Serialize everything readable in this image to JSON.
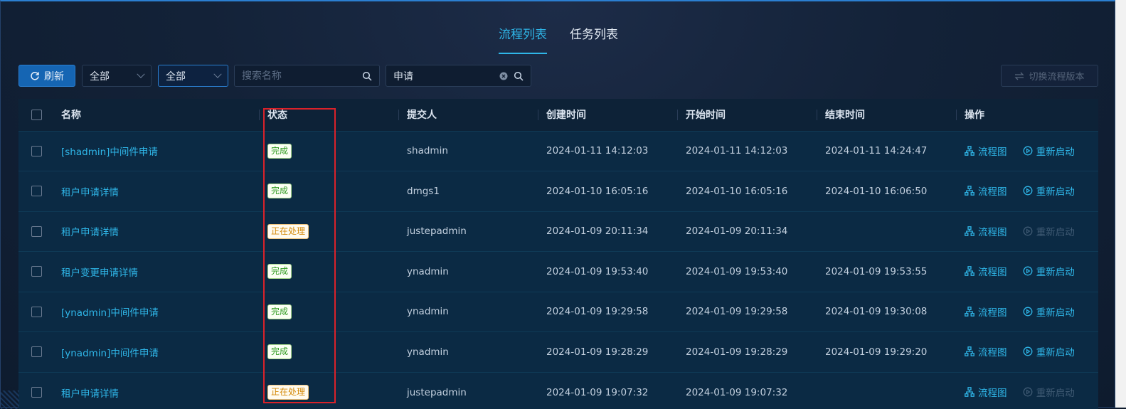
{
  "tabs": [
    {
      "label": "流程列表",
      "active": true
    },
    {
      "label": "任务列表",
      "active": false
    }
  ],
  "toolbar": {
    "refresh_label": "刷新",
    "select1_value": "全部",
    "select2_value": "全部",
    "search_name_placeholder": "搜索名称",
    "search_keyword_value": "申请",
    "switch_version_label": "切换流程版本"
  },
  "table": {
    "headers": [
      "名称",
      "状态",
      "提交人",
      "创建时间",
      "开始时间",
      "结束时间",
      "操作"
    ],
    "op_diagram_label": "流程图",
    "op_restart_label": "重新启动",
    "rows": [
      {
        "name": "[shadmin]中间件申请",
        "status": "完成",
        "status_type": "done",
        "submitter": "shadmin",
        "created": "2024-01-11 14:12:03",
        "started": "2024-01-11 14:12:03",
        "ended": "2024-01-11 14:24:47",
        "restart_enabled": true
      },
      {
        "name": "租户申请详情",
        "status": "完成",
        "status_type": "done",
        "submitter": "dmgs1",
        "created": "2024-01-10 16:05:16",
        "started": "2024-01-10 16:05:16",
        "ended": "2024-01-10 16:06:50",
        "restart_enabled": true
      },
      {
        "name": "租户申请详情",
        "status": "正在处理",
        "status_type": "proc",
        "submitter": "justepadmin",
        "created": "2024-01-09 20:11:34",
        "started": "2024-01-09 20:11:34",
        "ended": "",
        "restart_enabled": false
      },
      {
        "name": "租户变更申请详情",
        "status": "完成",
        "status_type": "done",
        "submitter": "ynadmin",
        "created": "2024-01-09 19:53:40",
        "started": "2024-01-09 19:53:40",
        "ended": "2024-01-09 19:53:55",
        "restart_enabled": true
      },
      {
        "name": "[ynadmin]中间件申请",
        "status": "完成",
        "status_type": "done",
        "submitter": "ynadmin",
        "created": "2024-01-09 19:29:58",
        "started": "2024-01-09 19:29:58",
        "ended": "2024-01-09 19:30:08",
        "restart_enabled": true
      },
      {
        "name": "[ynadmin]中间件申请",
        "status": "完成",
        "status_type": "done",
        "submitter": "ynadmin",
        "created": "2024-01-09 19:28:29",
        "started": "2024-01-09 19:28:29",
        "ended": "2024-01-09 19:29:20",
        "restart_enabled": true
      },
      {
        "name": "租户申请详情",
        "status": "正在处理",
        "status_type": "proc",
        "submitter": "justepadmin",
        "created": "2024-01-09 19:07:32",
        "started": "2024-01-09 19:07:32",
        "ended": "",
        "restart_enabled": false
      }
    ]
  },
  "colors": {
    "accent": "#2fb6e8",
    "primary_button": "#1565b3",
    "done_green": "#2e9a1f",
    "processing_orange": "#d48806",
    "highlight_red": "#d9222a"
  }
}
